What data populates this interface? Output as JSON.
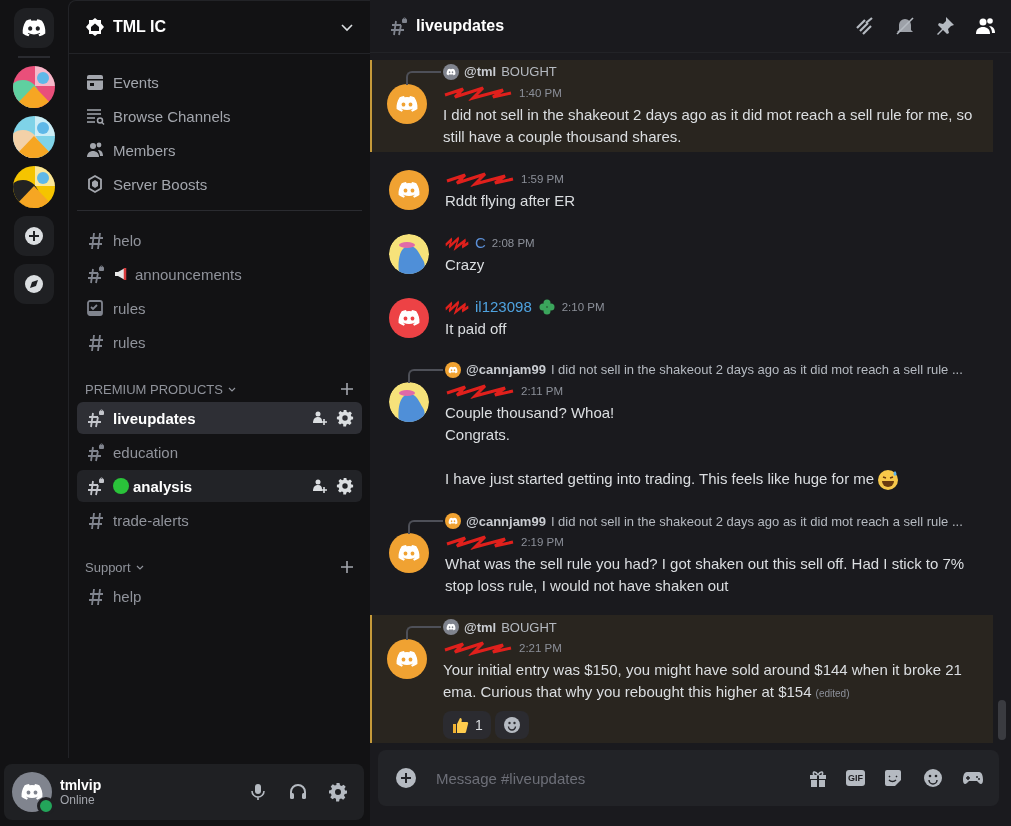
{
  "rail": [
    {
      "kind": "home"
    },
    {
      "kind": "picture"
    },
    {
      "kind": "picture"
    },
    {
      "kind": "picture"
    },
    {
      "kind": "add"
    },
    {
      "kind": "explore"
    }
  ],
  "sidebar": {
    "server_name": "TML IC",
    "menu": [
      {
        "kind": "events",
        "label": "Events"
      },
      {
        "kind": "browse",
        "label": "Browse Channels"
      },
      {
        "kind": "members",
        "label": "Members"
      },
      {
        "kind": "boosts",
        "label": "Server Boosts"
      }
    ],
    "channels": [
      {
        "name": "helo",
        "kind": "hash",
        "selected": false,
        "unread": false
      },
      {
        "name": "announcements",
        "kind": "locked-megaphone",
        "selected": false,
        "unread": false
      },
      {
        "name": "rules",
        "kind": "rules",
        "selected": false,
        "unread": false
      },
      {
        "name": "rules",
        "kind": "hash",
        "selected": false,
        "unread": false
      }
    ],
    "categories": [
      {
        "name": "PREMIUM PRODUCTS",
        "channels": [
          {
            "name": "liveupdates",
            "kind": "locked",
            "selected": true,
            "unread": true,
            "actions": true
          },
          {
            "name": "education",
            "kind": "locked",
            "selected": false,
            "unread": false
          },
          {
            "name": "analysis",
            "kind": "locked-dot",
            "selected": false,
            "unread": true,
            "hovered": true,
            "actions": true
          },
          {
            "name": "trade-alerts",
            "kind": "hash",
            "selected": false,
            "unread": false
          }
        ]
      },
      {
        "name": "Support",
        "channels": [
          {
            "name": "help",
            "kind": "hash",
            "selected": false,
            "unread": false
          }
        ]
      }
    ]
  },
  "user": {
    "name": "tmlvip",
    "status": "Online"
  },
  "header": {
    "channel": "liveupdates"
  },
  "messages": [
    {
      "highlighted": true,
      "reply": {
        "color": "#80848e",
        "mention": "@tml",
        "text": "BOUGHT"
      },
      "avatar": {
        "kind": "discord",
        "color": "#f0a232"
      },
      "redacted": true,
      "time": "1:40 PM",
      "paragraphs": [
        "I did not sell in the shakeout 2 days ago as it did mot reach a sell rule for me, so still have a couple thousand shares."
      ]
    },
    {
      "highlighted": false,
      "avatar": {
        "kind": "discord",
        "color": "#f0a232"
      },
      "redacted": true,
      "time": "1:59 PM",
      "paragraphs": [
        "Rddt flying after ER"
      ]
    },
    {
      "highlighted": false,
      "avatar": {
        "kind": "character",
        "color": "#f6e27a"
      },
      "redacted": true,
      "author": "C",
      "color": "#5b8fd6",
      "time": "2:08 PM",
      "paragraphs": [
        "Crazy"
      ]
    },
    {
      "highlighted": false,
      "avatar": {
        "kind": "discord",
        "color": "#ed4245"
      },
      "redacted": true,
      "author": "il123098",
      "color": "#4fa3e0",
      "badge": true,
      "time": "2:10 PM",
      "paragraphs": [
        "It paid off"
      ]
    },
    {
      "highlighted": false,
      "reply": {
        "color": "#f0a232",
        "mention": "@cannjam99",
        "text": "I did not sell in the shakeout 2 days ago as it did mot reach a sell rule ..."
      },
      "avatar": {
        "kind": "character",
        "color": "#f6e27a"
      },
      "redacted": true,
      "time": "2:11 PM",
      "paragraphs": [
        "Couple thousand? Whoa!\nCongrats.",
        "I have just started getting into trading. This feels like huge for me"
      ],
      "emoji": true
    },
    {
      "highlighted": false,
      "reply": {
        "color": "#f0a232",
        "mention": "@cannjam99",
        "text": "I did not sell in the shakeout 2 days ago as it did mot reach a sell rule ..."
      },
      "avatar": {
        "kind": "discord",
        "color": "#f0a232"
      },
      "redacted": true,
      "time": "2:19 PM",
      "paragraphs": [
        "What was the sell rule you had? I got shaken out this sell off. Had I stick to 7% stop loss rule, I would not have shaken out"
      ]
    },
    {
      "highlighted": true,
      "reply": {
        "color": "#80848e",
        "mention": "@tml",
        "text": "BOUGHT"
      },
      "avatar": {
        "kind": "discord",
        "color": "#f0a232"
      },
      "redacted": true,
      "time": "2:21 PM",
      "paragraphs": [
        "Your initial entry was $150, you might have sold around $144 when it broke 21 ema. Curious that why you rebought this higher at $154"
      ],
      "edited": "(edited)",
      "reactions": [
        {
          "kind": "thumbs-up",
          "count": "1"
        }
      ],
      "add_reaction": true
    }
  ],
  "composer": {
    "placeholder": "Message #liveupdates",
    "gif_label": "GIF"
  }
}
